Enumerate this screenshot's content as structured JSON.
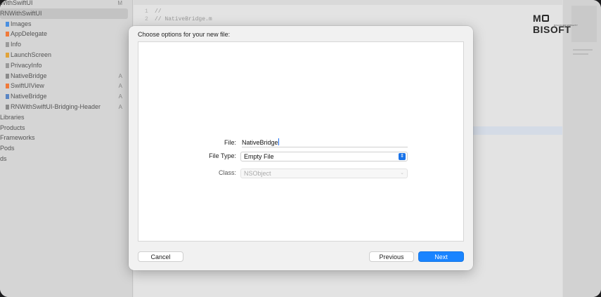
{
  "colors": {
    "accent": "#1a84ff",
    "sidebar_bg": "#d5d5d5",
    "sheet_bg": "#f1f1f1"
  },
  "navigator": {
    "items": [
      {
        "label": "WithSwiftUI",
        "status": "M",
        "icon": "folder-icon"
      },
      {
        "label": "RNWithSwiftUI",
        "status": "",
        "icon": "folder-icon",
        "selected": true
      },
      {
        "label": "Images",
        "status": "",
        "icon": "asset-catalog-icon"
      },
      {
        "label": "AppDelegate",
        "status": "",
        "icon": "swift-file-icon"
      },
      {
        "label": "Info",
        "status": "",
        "icon": "plist-icon"
      },
      {
        "label": "LaunchScreen",
        "status": "",
        "icon": "storyboard-icon"
      },
      {
        "label": "PrivacyInfo",
        "status": "",
        "icon": "plist-icon"
      },
      {
        "label": "NativeBridge",
        "status": "A",
        "icon": "header-file-icon"
      },
      {
        "label": "SwiftUIView",
        "status": "A",
        "icon": "swift-file-icon"
      },
      {
        "label": "NativeBridge",
        "status": "A",
        "icon": "objc-file-icon"
      },
      {
        "label": "RNWithSwiftUI-Bridging-Header",
        "status": "A",
        "icon": "header-file-icon"
      },
      {
        "label": "Libraries",
        "status": "",
        "icon": "folder-icon"
      },
      {
        "label": "Products",
        "status": "",
        "icon": "folder-icon"
      },
      {
        "label": "Frameworks",
        "status": "",
        "icon": "folder-icon"
      },
      {
        "label": "Pods",
        "status": "",
        "icon": "folder-icon"
      },
      {
        "label": "ds",
        "status": "",
        "icon": "folder-icon"
      }
    ]
  },
  "editor": {
    "lines": [
      {
        "number": "1",
        "text": "//"
      },
      {
        "number": "2",
        "text": "//  NativeBridge.m"
      }
    ]
  },
  "logo": {
    "text_before": "M",
    "text_after": "BISOFT",
    "tagline": "DISCOVER MOBILITY"
  },
  "dialog": {
    "title": "Choose options for your new file:",
    "file_label": "File:",
    "file_value": "NativeBridge",
    "file_type_label": "File Type:",
    "file_type_value": "Empty File",
    "class_label": "Class:",
    "class_value": "NSObject",
    "cancel_label": "Cancel",
    "previous_label": "Previous",
    "next_label": "Next"
  }
}
